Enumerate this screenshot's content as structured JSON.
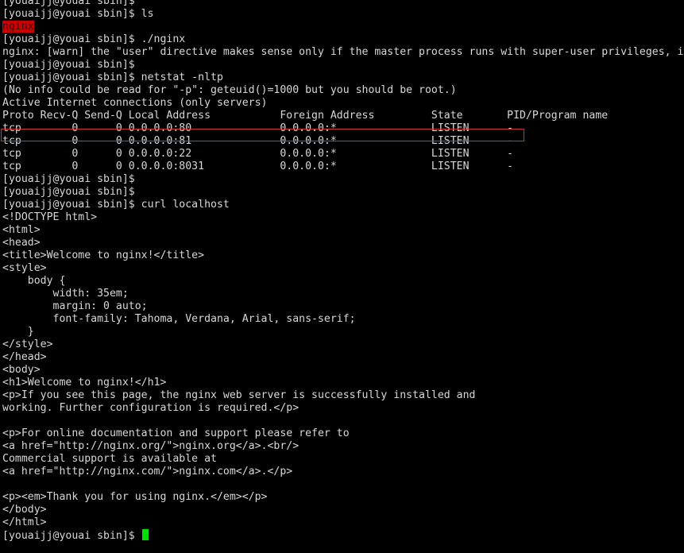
{
  "terminal": {
    "lines": [
      "[youaijj@youai sbin]$",
      "[youaijj@youai sbin]$ ls",
      "nginx",
      "[youaijj@youai sbin]$ ./nginx",
      "nginx: [warn] the \"user\" directive makes sense only if the master process runs with super-user privileges, i",
      "[youaijj@youai sbin]$",
      "[youaijj@youai sbin]$ netstat -nltp",
      "(No info could be read for \"-p\": geteuid()=1000 but you should be root.)",
      "Active Internet connections (only servers)",
      "Proto Recv-Q Send-Q Local Address           Foreign Address         State       PID/Program name",
      "tcp        0      0 0.0.0.0:80              0.0.0.0:*               LISTEN      -",
      "tcp        0      0 0.0.0.0:81              0.0.0.0:*               LISTEN      -",
      "tcp        0      0 0.0.0.0:22              0.0.0.0:*               LISTEN      -",
      "tcp        0      0 0.0.0.0:8031            0.0.0.0:*               LISTEN      -",
      "[youaijj@youai sbin]$",
      "[youaijj@youai sbin]$",
      "[youaijj@youai sbin]$ curl localhost",
      "<!DOCTYPE html>",
      "<html>",
      "<head>",
      "<title>Welcome to nginx!</title>",
      "<style>",
      "    body {",
      "        width: 35em;",
      "        margin: 0 auto;",
      "        font-family: Tahoma, Verdana, Arial, sans-serif;",
      "    }",
      "</style>",
      "</head>",
      "<body>",
      "<h1>Welcome to nginx!</h1>",
      "<p>If you see this page, the nginx web server is successfully installed and",
      "working. Further configuration is required.</p>",
      "",
      "<p>For online documentation and support please refer to",
      "<a href=\"http://nginx.org/\">nginx.org</a>.<br/>",
      "Commercial support is available at",
      "<a href=\"http://nginx.com/\">nginx.com</a>.</p>",
      "",
      "<p><em>Thank you for using nginx.</em></p>",
      "</body>",
      "</html>",
      "[youaijj@youai sbin]$ "
    ],
    "highlighted_line_index": 2,
    "boxed_line_index": 10,
    "cursor_line_index": 42
  },
  "colors": {
    "background": "#000000",
    "text": "#d8d8d8",
    "file_highlight_bg": "#c80000",
    "box_outline": "#c83232",
    "cursor": "#00e000"
  }
}
